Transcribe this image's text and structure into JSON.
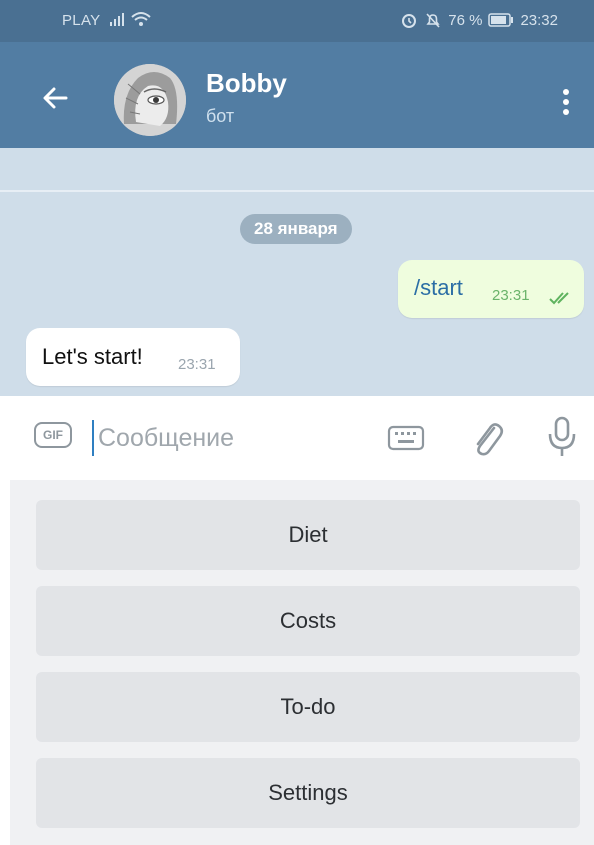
{
  "status_bar": {
    "carrier": "PLAY",
    "battery": "76 %",
    "time": "23:32"
  },
  "header": {
    "name": "Bobby",
    "subtitle": "бот"
  },
  "chat": {
    "date_badge": "28 января",
    "messages": [
      {
        "text": "/start",
        "time": "23:31",
        "direction": "outgoing"
      },
      {
        "text": "Let's start!",
        "time": "23:31",
        "direction": "incoming"
      }
    ]
  },
  "composer": {
    "gif_label": "GIF",
    "placeholder": "Сообщение"
  },
  "bot_keyboard": {
    "buttons": [
      "Diet",
      "Costs",
      "To-do",
      "Settings"
    ]
  },
  "colors": {
    "header": "#527da3",
    "status_bar": "#4a7092",
    "chat_background": "#cfdde9",
    "outgoing_bubble": "#effdde",
    "keyboard_button": "#e2e4e7"
  }
}
